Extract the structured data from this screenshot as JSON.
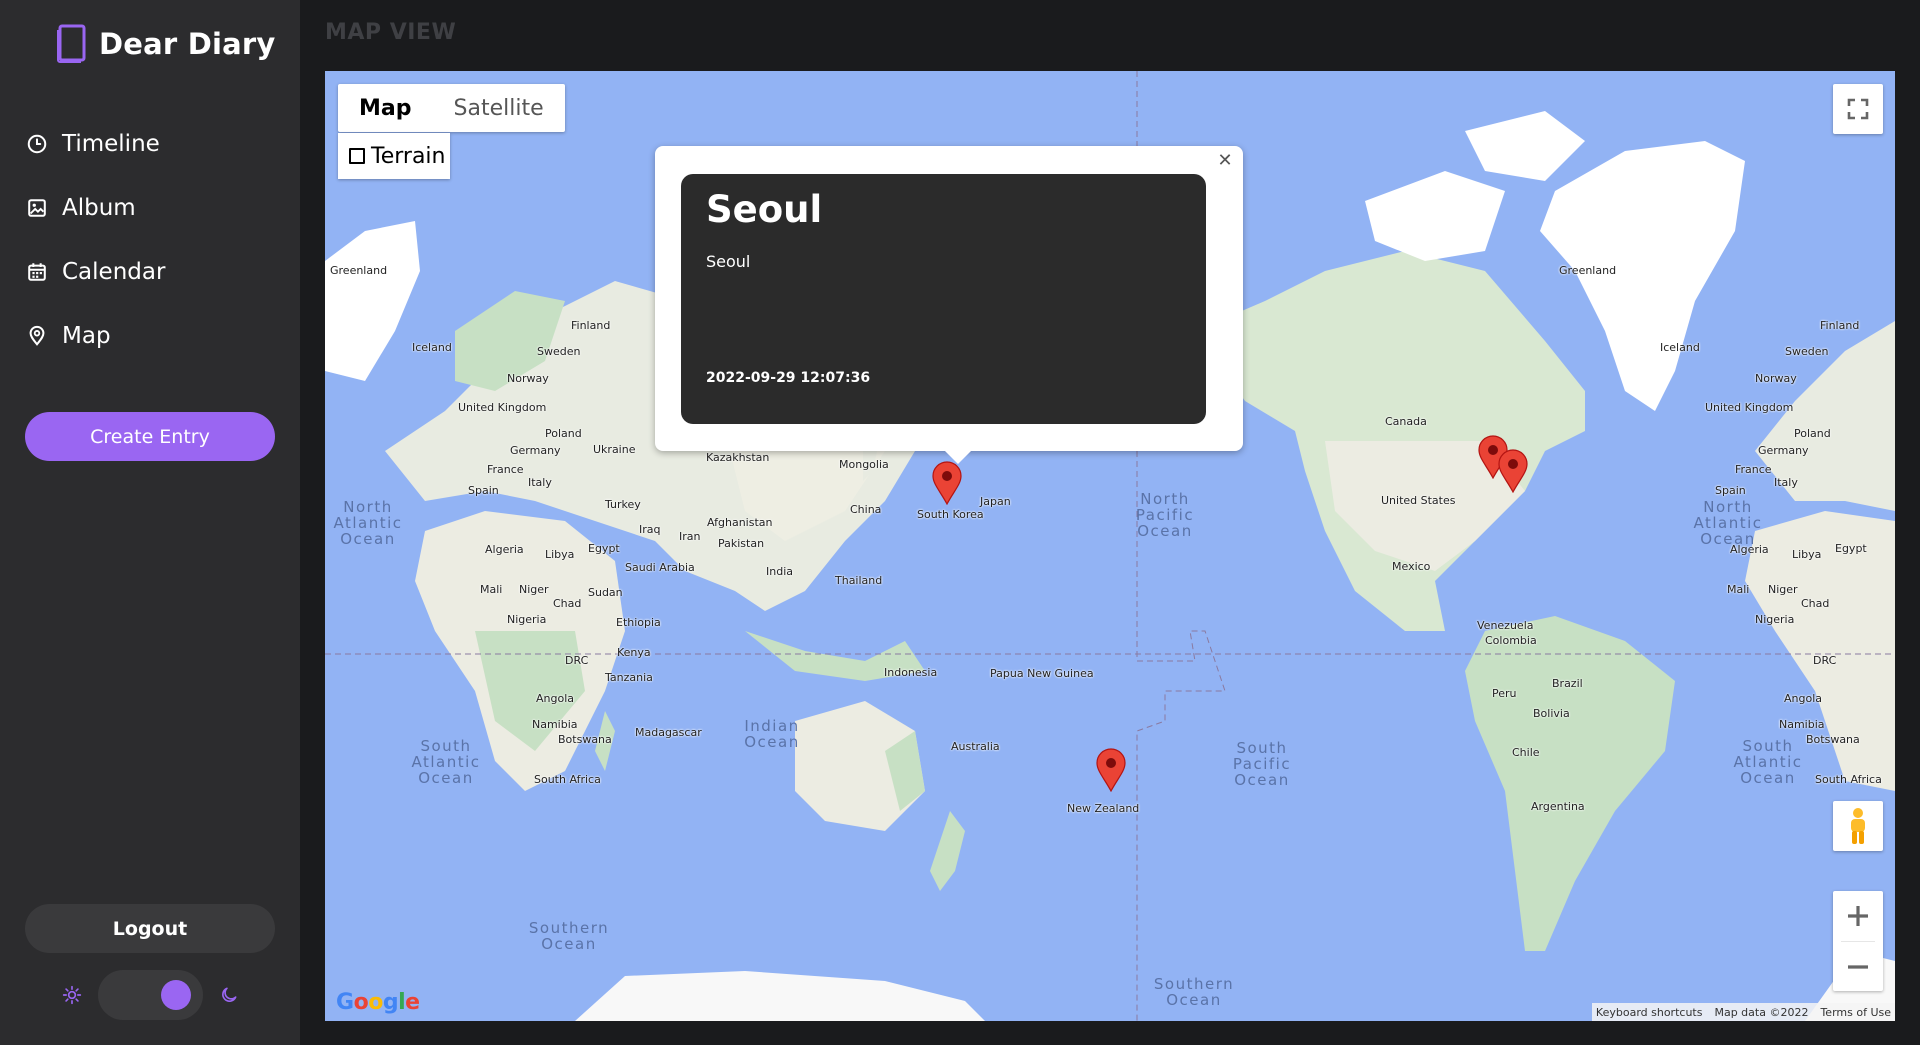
{
  "app": {
    "title": "Dear Diary"
  },
  "sidebar": {
    "nav": [
      {
        "label": "Timeline",
        "icon": "clock-icon"
      },
      {
        "label": "Album",
        "icon": "image-icon"
      },
      {
        "label": "Calendar",
        "icon": "calendar-icon"
      },
      {
        "label": "Map",
        "icon": "map-pin-icon"
      }
    ],
    "create_label": "Create Entry",
    "logout_label": "Logout",
    "theme": {
      "light_icon": "sun-icon",
      "dark_icon": "moon-icon",
      "mode": "dark"
    }
  },
  "page": {
    "title": "MAP VIEW"
  },
  "map": {
    "type_buttons": [
      "Map",
      "Satellite"
    ],
    "active_type": "Map",
    "terrain_label": "Terrain",
    "terrain_checked": false,
    "attribution": {
      "shortcuts": "Keyboard shortcuts",
      "data": "Map data ©2022",
      "terms": "Terms of Use"
    },
    "logo": "Google",
    "controls": [
      "fullscreen-icon",
      "pegman-icon",
      "zoom-in-icon",
      "zoom-out-icon"
    ],
    "country_labels": [
      "Greenland",
      "Iceland",
      "Finland",
      "Sweden",
      "Norway",
      "United Kingdom",
      "Poland",
      "Germany",
      "France",
      "Spain",
      "Italy",
      "Ukraine",
      "Kazakhstan",
      "Mongolia",
      "Turkey",
      "Iraq",
      "Iran",
      "Afghanistan",
      "Pakistan",
      "China",
      "Japan",
      "South Korea",
      "India",
      "Thailand",
      "Algeria",
      "Libya",
      "Egypt",
      "Saudi Arabia",
      "Mali",
      "Niger",
      "Chad",
      "Sudan",
      "Nigeria",
      "Ethiopia",
      "Kenya",
      "DRC",
      "Tanzania",
      "Angola",
      "Namibia",
      "Botswana",
      "Madagascar",
      "South Africa",
      "Indonesia",
      "Papua New Guinea",
      "Australia",
      "New Zealand",
      "Canada",
      "United States",
      "Mexico",
      "Venezuela",
      "Colombia",
      "Peru",
      "Brazil",
      "Bolivia",
      "Chile",
      "Argentina",
      "Greenland",
      "Iceland",
      "Finland",
      "Sweden",
      "Norway",
      "United Kingdom",
      "Poland",
      "Germany",
      "France",
      "Spain",
      "Italy",
      "Algeria",
      "Libya",
      "Egypt",
      "Mali",
      "Niger",
      "Chad",
      "Nigeria",
      "DRC",
      "Angola",
      "Namibia",
      "Botswana",
      "South Africa"
    ],
    "ocean_labels": [
      "North Atlantic Ocean",
      "South Atlantic Ocean",
      "Indian Ocean",
      "Southern Ocean",
      "North Pacific Ocean",
      "South Pacific Ocean",
      "North Atlantic Ocean",
      "South Atlantic Ocean",
      "Southern Ocean"
    ],
    "markers": [
      "Seoul",
      "New Zealand",
      "United States",
      "United States"
    ],
    "info_window": {
      "title": "Seoul",
      "body": "Seoul",
      "date": "2022-09-29 12:07:36"
    }
  },
  "colors": {
    "accent": "#9a66f2",
    "sidebar_bg": "#2c2c2e",
    "page_bg": "#1a1b1d",
    "ocean": "#92b3f4",
    "land": "#e8ebe1",
    "forest": "#c7e0c4",
    "marker": "#d93025",
    "card_bg": "#2b2b2b"
  }
}
